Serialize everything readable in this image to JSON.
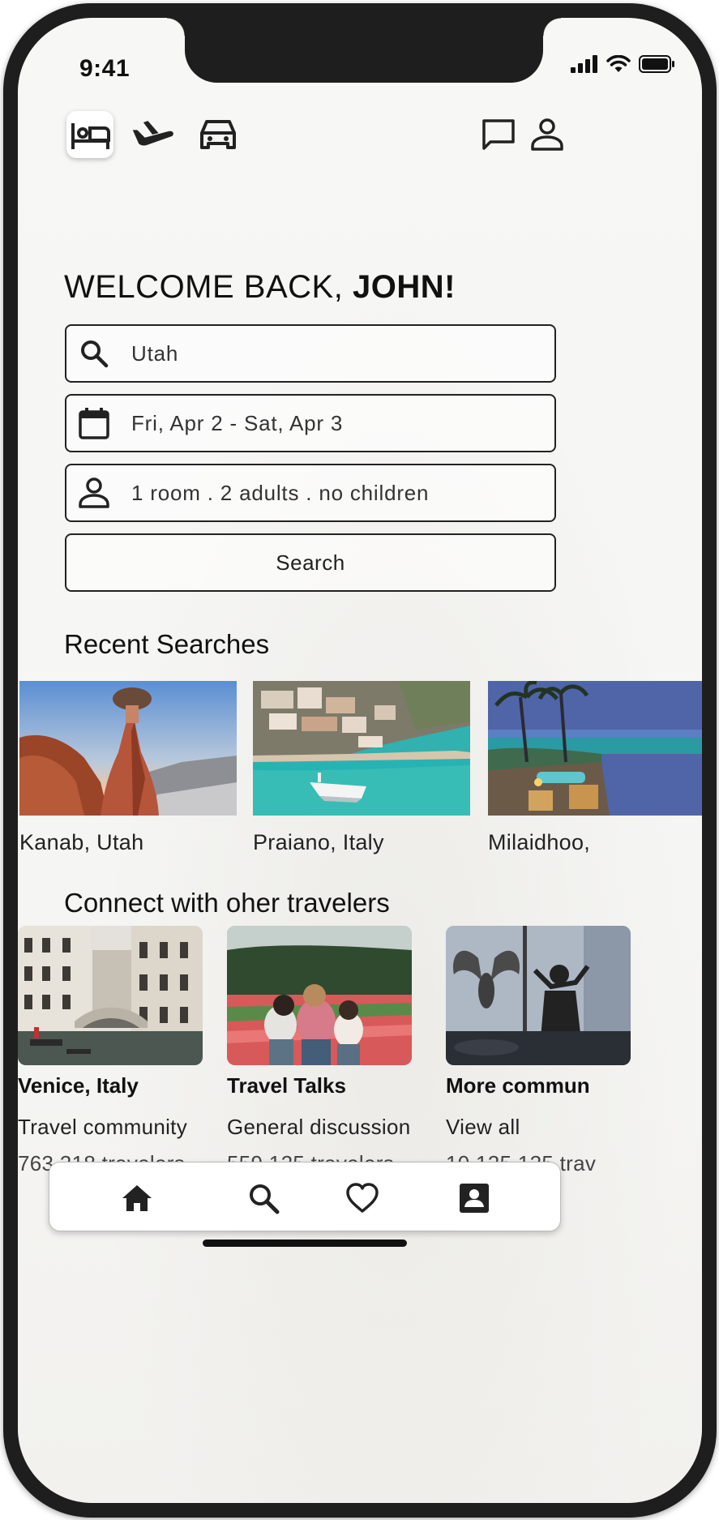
{
  "status_bar": {
    "time": "9:41"
  },
  "top_nav": {
    "left": [
      {
        "name": "bed-icon",
        "active": true
      },
      {
        "name": "airplane-icon",
        "active": false
      },
      {
        "name": "car-icon",
        "active": false
      }
    ],
    "right": [
      "chat-icon",
      "profile-icon"
    ]
  },
  "welcome": {
    "prefix": "WELCOME BACK, ",
    "name": "JOHN!"
  },
  "search_form": {
    "destination": {
      "value": "Utah",
      "icon": "search-icon"
    },
    "dates": {
      "value": "Fri, Apr 2 - Sat, Apr 3",
      "icon": "calendar-icon"
    },
    "guests": {
      "value": "1 room . 2 adults . no children",
      "icon": "person-icon"
    },
    "submit_label": "Search"
  },
  "recent_searches": {
    "title": "Recent Searches",
    "items": [
      {
        "label": "Kanab, Utah"
      },
      {
        "label": "Praiano, Italy"
      },
      {
        "label": "Milaidhoo,"
      }
    ]
  },
  "community": {
    "title": "Connect with oher travelers",
    "items": [
      {
        "title": "Venice, Italy",
        "subtitle": "Travel community",
        "count": "763,218 travelers"
      },
      {
        "title": "Travel Talks",
        "subtitle": "General discussion",
        "count": "559,125 travelers"
      },
      {
        "title": "More commun",
        "subtitle": "View all",
        "count": "10,125,125 trav"
      }
    ]
  },
  "bottom_nav": {
    "items": [
      "home-icon",
      "search-icon",
      "heart-icon",
      "contact-card-icon"
    ]
  },
  "colors": {
    "frame": "#1e1e1e",
    "text": "#111111",
    "screen_bg": "#f6f6f5"
  }
}
